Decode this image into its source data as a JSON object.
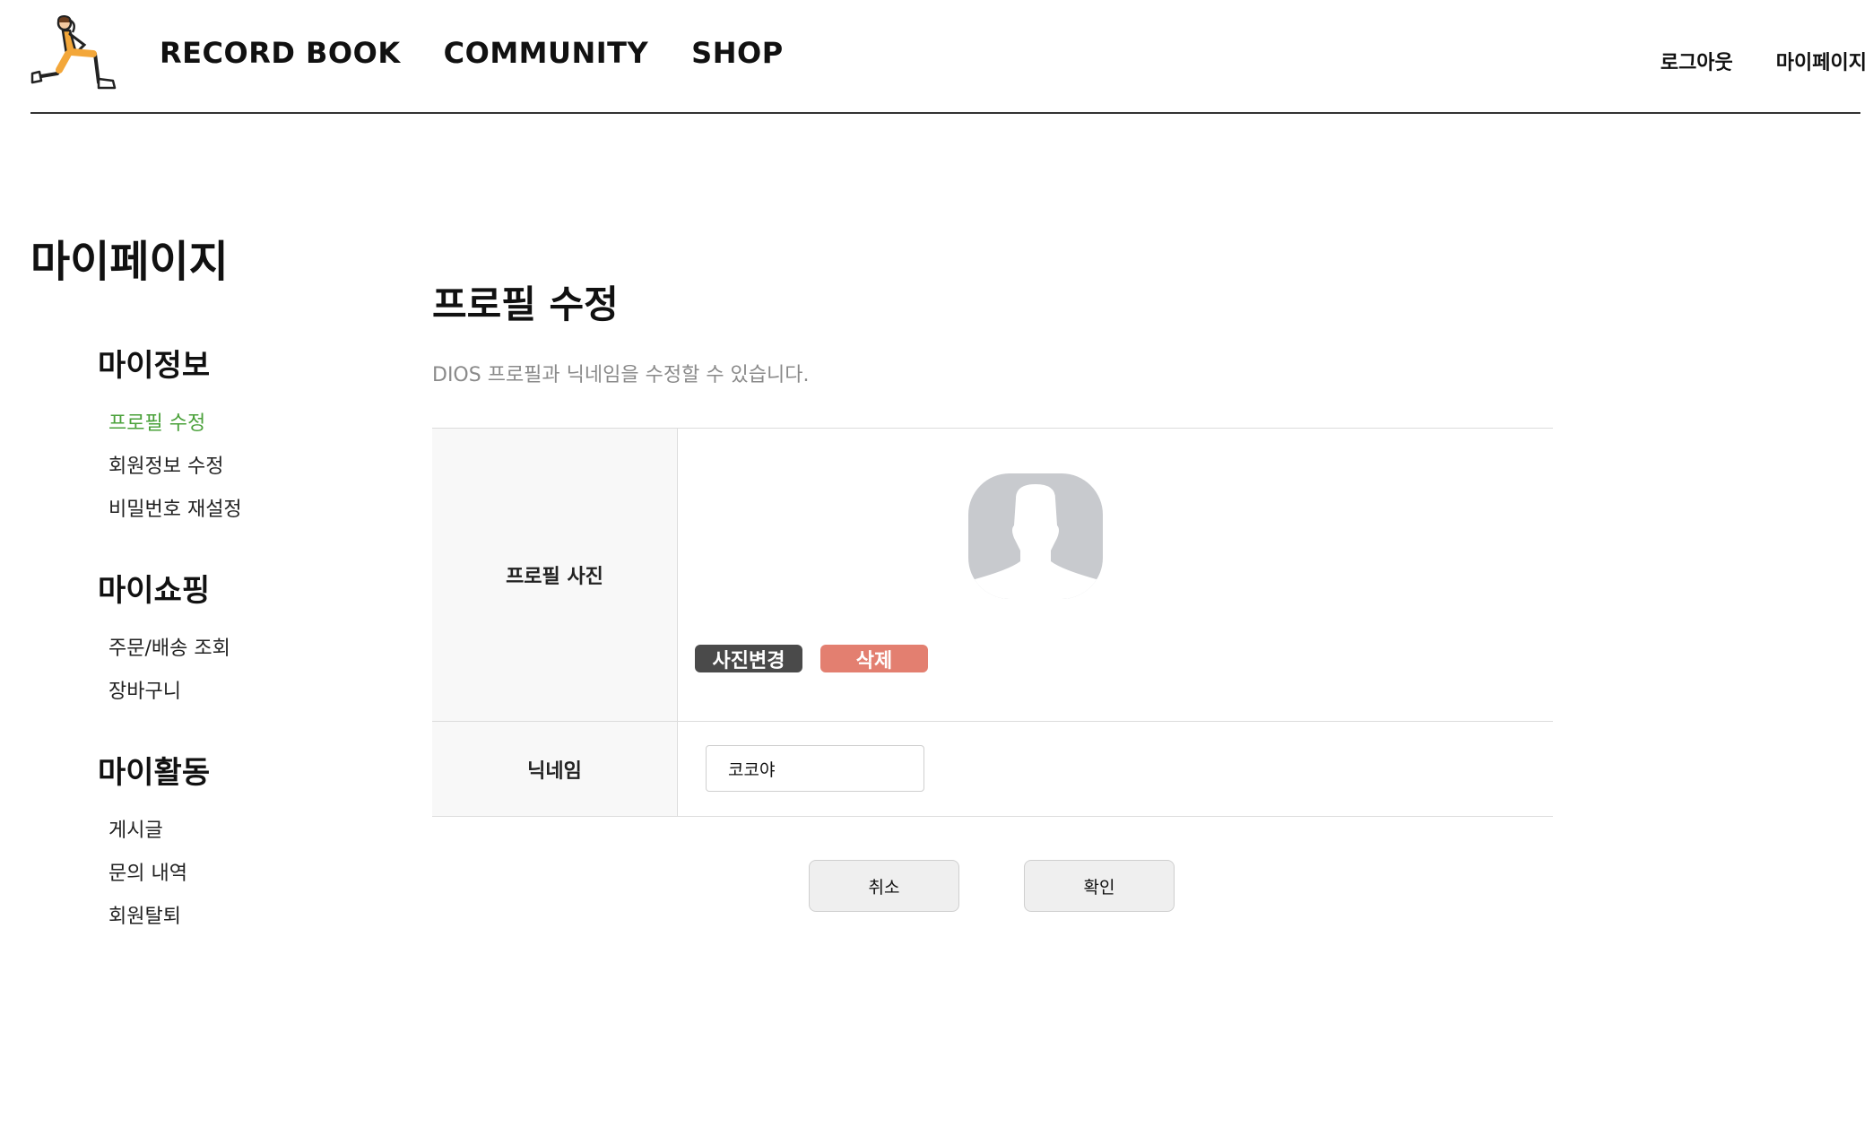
{
  "header": {
    "logo": "runner-lunge-logo",
    "nav": [
      "RECORD BOOK",
      "COMMUNITY",
      "SHOP"
    ],
    "util": {
      "logout": "로그아웃",
      "mypage": "마이페이지"
    }
  },
  "sidebar": {
    "title": "마이페이지",
    "groups": [
      {
        "heading": "마이정보",
        "items": [
          "프로필 수정",
          "회원정보 수정",
          "비밀번호 재설정"
        ]
      },
      {
        "heading": "마이쇼핑",
        "items": [
          "주문/배송 조회",
          "장바구니"
        ]
      },
      {
        "heading": "마이활동",
        "items": [
          "게시글",
          "문의 내역",
          "회원탈퇴"
        ]
      }
    ],
    "active_item": "프로필 수정",
    "active_color": "#4aa13a"
  },
  "main": {
    "title": "프로필 수정",
    "description": "DIOS 프로필과 닉네임을 수정할 수 있습니다.",
    "photo_label": "프로필 사진",
    "change_photo": "사진변경",
    "delete_photo": "삭제",
    "nickname_label": "닉네임",
    "nickname_value": "코코야",
    "cancel": "취소",
    "confirm": "확인"
  },
  "colors": {
    "accent": "#4aa13a",
    "delete_button": "#e37f70",
    "change_button": "#4a4a4a",
    "avatar": "#c8cace"
  }
}
